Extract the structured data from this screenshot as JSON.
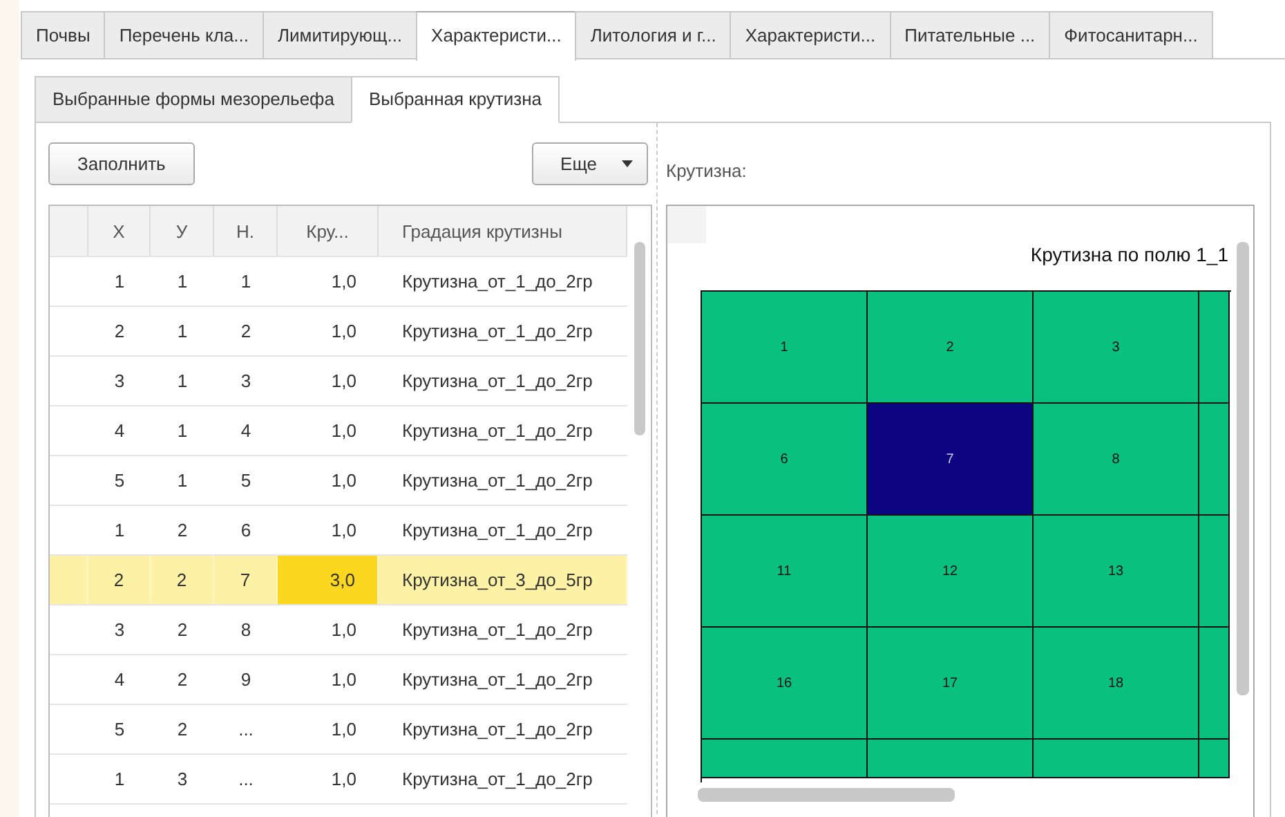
{
  "tabs": [
    {
      "label": "Почвы",
      "selected": false
    },
    {
      "label": "Перечень кла...",
      "selected": false
    },
    {
      "label": "Лимитирующ...",
      "selected": false
    },
    {
      "label": "Характеристи...",
      "selected": true
    },
    {
      "label": "Литология и г...",
      "selected": false
    },
    {
      "label": "Характеристи...",
      "selected": false
    },
    {
      "label": "Питательные ...",
      "selected": false
    },
    {
      "label": "Фитосанитарн...",
      "selected": false
    }
  ],
  "subtabs": [
    {
      "label": "Выбранные формы мезорельефа",
      "selected": false
    },
    {
      "label": "Выбранная крутизна",
      "selected": true
    }
  ],
  "toolbar": {
    "fill_button": "Заполнить",
    "more_button": "Еще"
  },
  "table": {
    "columns": [
      "X",
      "У",
      "Н.",
      "Кру...",
      "Градация крутизны"
    ],
    "rows": [
      {
        "selected": false,
        "cells": [
          {
            "text": "1",
            "focused": false
          },
          {
            "text": "1",
            "focused": false
          },
          {
            "text": "1",
            "focused": false
          },
          {
            "text": "1,0",
            "focused": false
          },
          {
            "text": "Крутизна_от_1_до_2гр",
            "focused": false
          }
        ]
      },
      {
        "selected": false,
        "cells": [
          {
            "text": "2",
            "focused": false
          },
          {
            "text": "1",
            "focused": false
          },
          {
            "text": "2",
            "focused": false
          },
          {
            "text": "1,0",
            "focused": false
          },
          {
            "text": "Крутизна_от_1_до_2гр",
            "focused": false
          }
        ]
      },
      {
        "selected": false,
        "cells": [
          {
            "text": "3",
            "focused": false
          },
          {
            "text": "1",
            "focused": false
          },
          {
            "text": "3",
            "focused": false
          },
          {
            "text": "1,0",
            "focused": false
          },
          {
            "text": "Крутизна_от_1_до_2гр",
            "focused": false
          }
        ]
      },
      {
        "selected": false,
        "cells": [
          {
            "text": "4",
            "focused": false
          },
          {
            "text": "1",
            "focused": false
          },
          {
            "text": "4",
            "focused": false
          },
          {
            "text": "1,0",
            "focused": false
          },
          {
            "text": "Крутизна_от_1_до_2гр",
            "focused": false
          }
        ]
      },
      {
        "selected": false,
        "cells": [
          {
            "text": "5",
            "focused": false
          },
          {
            "text": "1",
            "focused": false
          },
          {
            "text": "5",
            "focused": false
          },
          {
            "text": "1,0",
            "focused": false
          },
          {
            "text": "Крутизна_от_1_до_2гр",
            "focused": false
          }
        ]
      },
      {
        "selected": false,
        "cells": [
          {
            "text": "1",
            "focused": false
          },
          {
            "text": "2",
            "focused": false
          },
          {
            "text": "6",
            "focused": false
          },
          {
            "text": "1,0",
            "focused": false
          },
          {
            "text": "Крутизна_от_1_до_2гр",
            "focused": false
          }
        ]
      },
      {
        "selected": true,
        "cells": [
          {
            "text": "2",
            "focused": false
          },
          {
            "text": "2",
            "focused": false
          },
          {
            "text": "7",
            "focused": false
          },
          {
            "text": "3,0",
            "focused": true
          },
          {
            "text": "Крутизна_от_3_до_5гр",
            "focused": false
          }
        ]
      },
      {
        "selected": false,
        "cells": [
          {
            "text": "3",
            "focused": false
          },
          {
            "text": "2",
            "focused": false
          },
          {
            "text": "8",
            "focused": false
          },
          {
            "text": "1,0",
            "focused": false
          },
          {
            "text": "Крутизна_от_1_до_2гр",
            "focused": false
          }
        ]
      },
      {
        "selected": false,
        "cells": [
          {
            "text": "4",
            "focused": false
          },
          {
            "text": "2",
            "focused": false
          },
          {
            "text": "9",
            "focused": false
          },
          {
            "text": "1,0",
            "focused": false
          },
          {
            "text": "Крутизна_от_1_до_2гр",
            "focused": false
          }
        ]
      },
      {
        "selected": false,
        "cells": [
          {
            "text": "5",
            "focused": false
          },
          {
            "text": "2",
            "focused": false
          },
          {
            "text": "...",
            "focused": false
          },
          {
            "text": "1,0",
            "focused": false
          },
          {
            "text": "Крутизна_от_1_до_2гр",
            "focused": false
          }
        ]
      },
      {
        "selected": false,
        "cells": [
          {
            "text": "1",
            "focused": false
          },
          {
            "text": "3",
            "focused": false
          },
          {
            "text": "...",
            "focused": false
          },
          {
            "text": "1,0",
            "focused": false
          },
          {
            "text": "Крутизна_от_1_до_2гр",
            "focused": false
          }
        ]
      }
    ]
  },
  "map": {
    "label": "Крутизна:",
    "title": "Крутизна по полю 1_1",
    "rows": [
      [
        {
          "label": "1",
          "color": "#0ac080"
        },
        {
          "label": "2",
          "color": "#0ac080"
        },
        {
          "label": "3",
          "color": "#0ac080"
        }
      ],
      [
        {
          "label": "6",
          "color": "#0ac080"
        },
        {
          "label": "7",
          "color": "#0c0480"
        },
        {
          "label": "8",
          "color": "#0ac080"
        }
      ],
      [
        {
          "label": "11",
          "color": "#0ac080"
        },
        {
          "label": "12",
          "color": "#0ac080"
        },
        {
          "label": "13",
          "color": "#0ac080"
        }
      ],
      [
        {
          "label": "16",
          "color": "#0ac080"
        },
        {
          "label": "17",
          "color": "#0ac080"
        },
        {
          "label": "18",
          "color": "#0ac080"
        }
      ]
    ]
  }
}
